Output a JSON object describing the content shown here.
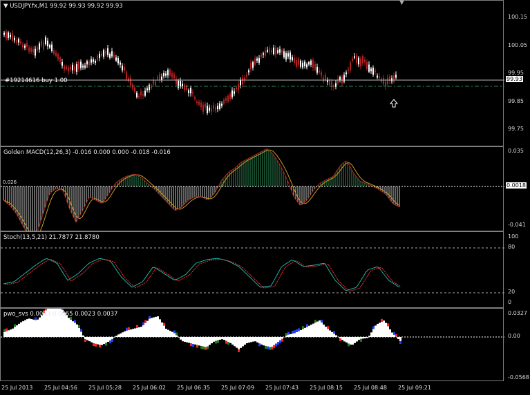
{
  "main": {
    "title": "USDJPY.fx,M1",
    "ohlc": "99.92 99.93 99.92 99.93",
    "order_label": "#19214616 buy 1.00",
    "current_price": "99.93",
    "scale": [
      "100.15",
      "100.05",
      "99.95",
      "99.85",
      "99.75"
    ]
  },
  "macd": {
    "title": "Golden MACD(12,26,3) -0.016 0.000 0.000 -0.018 -0.016",
    "left_marker": "0.026",
    "level": "0.0018",
    "scale": [
      "0.035",
      "-0.041"
    ]
  },
  "stoch": {
    "title": "Stoch(13,5,21) 21.7877 21.8780",
    "scale": [
      "100",
      "80",
      "20",
      "0"
    ]
  },
  "pwo": {
    "title": "pwo_svs 0.0083 0.0065 0.0023 0.0037",
    "scale": [
      "0.0327",
      "0.00",
      "-0.0568"
    ]
  },
  "time_axis": [
    "25 Jul 2013",
    "25 Jul 04:56",
    "25 Jul 05:28",
    "25 Jul 06:02",
    "25 Jul 06:35",
    "25 Jul 07:09",
    "25 Jul 07:43",
    "25 Jul 08:15",
    "25 Jul 08:48",
    "25 Jul 09:21"
  ],
  "colors": {
    "bull": "#ffffff",
    "bear": "#b22222",
    "macd_pos": "#b22222",
    "macd_neg": "#2e8b57",
    "stoch_main": "#20b2aa",
    "stoch_signal": "#ff3030",
    "order_line": "#2e8b57"
  }
}
